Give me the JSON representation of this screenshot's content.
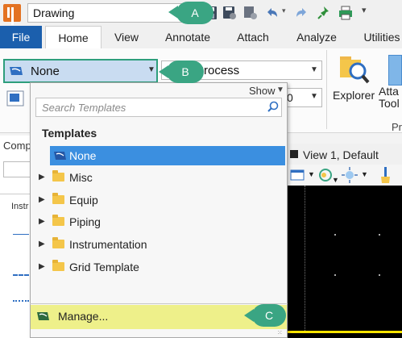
{
  "quick_access": {
    "workflow_value": "Drawing",
    "icons": [
      "app-logo-icon",
      "save-icon",
      "save-settings-icon",
      "settings-icon",
      "undo-icon",
      "redo-icon",
      "pin-icon",
      "print-icon",
      "customize-icon"
    ]
  },
  "ribbon": {
    "tabs": [
      "File",
      "Home",
      "View",
      "Annotate",
      "Attach",
      "Analyze",
      "Utilities"
    ],
    "active_tab": "Home",
    "template_combo_value": "None",
    "process_combo_value": "Process",
    "small_combo_value": "0",
    "explorer_label": "Explorer",
    "attach_tools_label": "Atta\nTool",
    "group_partial_label": "Pr"
  },
  "left_pane": {
    "title": "Comp",
    "column_label": "Instr"
  },
  "view": {
    "title": "View 1, Default"
  },
  "template_dropdown": {
    "show_label": "Show",
    "search_placeholder": "Search Templates",
    "heading": "Templates",
    "items": [
      {
        "label": "None",
        "selected": true,
        "expandable": false
      },
      {
        "label": "Misc",
        "selected": false,
        "expandable": true
      },
      {
        "label": "Equip",
        "selected": false,
        "expandable": true
      },
      {
        "label": "Piping",
        "selected": false,
        "expandable": true
      },
      {
        "label": "Instrumentation",
        "selected": false,
        "expandable": true
      },
      {
        "label": "Grid Template",
        "selected": false,
        "expandable": true
      }
    ],
    "manage_label": "Manage..."
  },
  "callouts": {
    "a": "A",
    "b": "B",
    "c": "C"
  },
  "colors": {
    "file_tab": "#1b5fad",
    "callout": "#3aa583",
    "selected_row": "#3b8fe0",
    "manage_highlight": "#eef08a",
    "combo_highlight_border": "#2e9e7c"
  }
}
